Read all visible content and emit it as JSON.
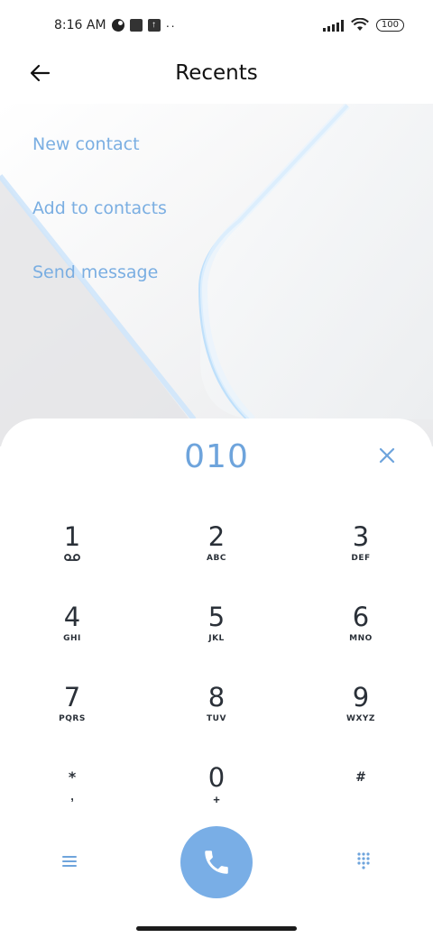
{
  "status_bar": {
    "time": "8:16 AM",
    "dots": "··",
    "battery": "100"
  },
  "header": {
    "title": "Recents",
    "back_icon": "back-arrow-icon"
  },
  "actions": [
    {
      "label": "New contact"
    },
    {
      "label": "Add to contacts"
    },
    {
      "label": "Send message"
    }
  ],
  "dialer": {
    "number": "010",
    "clear_icon": "close-icon",
    "keys": [
      {
        "digit": "1",
        "letters": ""
      },
      {
        "digit": "2",
        "letters": "ABC"
      },
      {
        "digit": "3",
        "letters": "DEF"
      },
      {
        "digit": "4",
        "letters": "GHI"
      },
      {
        "digit": "5",
        "letters": "JKL"
      },
      {
        "digit": "6",
        "letters": "MNO"
      },
      {
        "digit": "7",
        "letters": "PQRS"
      },
      {
        "digit": "8",
        "letters": "TUV"
      },
      {
        "digit": "9",
        "letters": "WXYZ"
      },
      {
        "digit": "*",
        "letters": ","
      },
      {
        "digit": "0",
        "letters": "+"
      },
      {
        "digit": "#",
        "letters": ""
      }
    ],
    "menu_icon": "menu-icon",
    "call_icon": "phone-icon",
    "keypad_icon": "dialpad-icon"
  },
  "colors": {
    "accent": "#79aee6",
    "action_text": "#7aaee2",
    "key_text": "#2a3038"
  }
}
